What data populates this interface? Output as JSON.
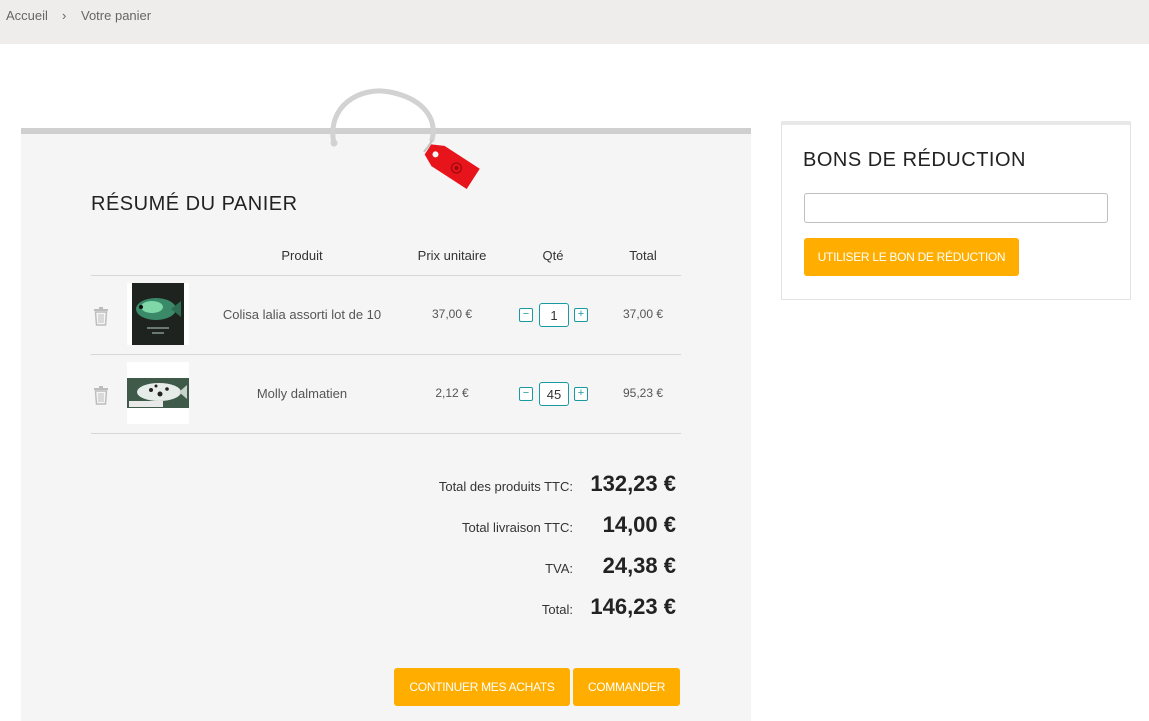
{
  "breadcrumb": {
    "home": "Accueil",
    "separator": "›",
    "current": "Votre panier"
  },
  "cart": {
    "title": "RÉSUMÉ DU PANIER",
    "columns": {
      "product": "Produit",
      "unit_price": "Prix unitaire",
      "qty": "Qté",
      "total": "Total"
    },
    "items": [
      {
        "name": "Colisa lalia assorti lot de 10",
        "unit_price": "37,00 €",
        "qty": "1",
        "total": "37,00 €",
        "image": "fish-photo-dark-green",
        "minus": "−",
        "plus": "+"
      },
      {
        "name": "Molly dalmatien",
        "unit_price": "2,12 €",
        "qty": "45",
        "total": "95,23 €",
        "image": "fish-photo-dalmatian",
        "minus": "−",
        "plus": "+"
      }
    ],
    "summary": {
      "products_label": "Total des produits TTC:",
      "products_value": "132,23 €",
      "shipping_label": "Total livraison TTC:",
      "shipping_value": "14,00 €",
      "tax_label": "TVA:",
      "tax_value": "24,38 €",
      "total_label": "Total:",
      "total_value": "146,23 €"
    },
    "buttons": {
      "continue": "CONTINUER MES ACHATS",
      "order": "COMMANDER"
    }
  },
  "voucher": {
    "title": "BONS DE RÉDUCTION",
    "input_value": "",
    "button": "UTILISER LE BON DE RÉDUCTION"
  },
  "colors": {
    "accent": "#ffae00",
    "qty_border": "#1a9aa0",
    "tag_red": "#e8141b"
  }
}
